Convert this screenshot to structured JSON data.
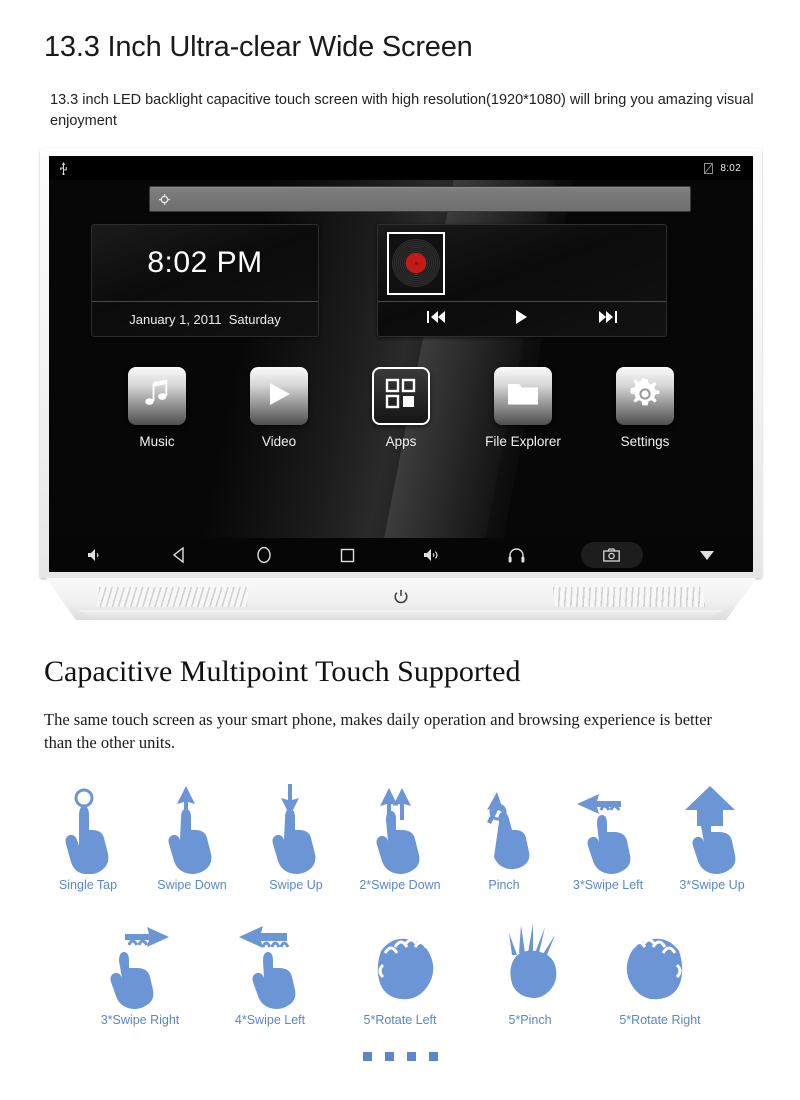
{
  "colors": {
    "accent_blue": "#5b87c9",
    "hand_blue": "#6c95d6",
    "screen_black": "#070707",
    "bezel_white": "#f4f4f4",
    "vinyl_red": "#c31a1a"
  },
  "section1": {
    "title": "13.3 Inch Ultra-clear Wide Screen",
    "description": "13.3 inch LED backlight capacitive touch screen with high resolution(1920*1080) will bring you amazing visual enjoyment"
  },
  "device": {
    "status_bar": {
      "left_icons": [
        "usb-icon"
      ],
      "right_icons": [
        "sd-card-icon"
      ],
      "time": "8:02"
    },
    "search_bar": {
      "icon": "google-search-icon",
      "value": "",
      "placeholder": ""
    },
    "clock_widget": {
      "time": "8:02 PM",
      "date": "January 1, 2011  Saturday"
    },
    "media_widget": {
      "album_art": "vinyl-record-icon",
      "controls": [
        {
          "name": "previous-track-button",
          "icon": "skip-previous-icon"
        },
        {
          "name": "play-button",
          "icon": "play-icon"
        },
        {
          "name": "next-track-button",
          "icon": "skip-next-icon"
        }
      ]
    },
    "apps": [
      {
        "label": "Music",
        "icon": "music-note-icon",
        "highlighted": false
      },
      {
        "label": "Video",
        "icon": "play-icon",
        "highlighted": false
      },
      {
        "label": "Apps",
        "icon": "app-grid-icon",
        "highlighted": true
      },
      {
        "label": "File Explorer",
        "icon": "folder-icon",
        "highlighted": false
      },
      {
        "label": "Settings",
        "icon": "gear-icon",
        "highlighted": false
      }
    ],
    "nav_buttons": [
      {
        "name": "volume-down-button",
        "icon": "volume-down-icon"
      },
      {
        "name": "back-button",
        "icon": "back-triangle-icon"
      },
      {
        "name": "home-button",
        "icon": "home-circle-icon"
      },
      {
        "name": "recents-button",
        "icon": "recents-square-icon"
      },
      {
        "name": "volume-up-button",
        "icon": "volume-up-icon"
      },
      {
        "name": "headphone-button",
        "icon": "headphone-icon"
      },
      {
        "name": "screenshot-button",
        "icon": "camera-icon"
      },
      {
        "name": "hide-navbar-button",
        "icon": "chevron-down-icon"
      }
    ],
    "base": {
      "power_icon": "power-icon"
    }
  },
  "section2": {
    "title": "Capacitive Multipoint Touch Supported",
    "description": "The same touch screen as your smart phone, makes daily operation and browsing experience is better than the other units.",
    "gestures_row1": [
      {
        "label": "Single Tap",
        "icon": "hand-single-tap-icon"
      },
      {
        "label": "Swipe Down",
        "icon": "hand-swipe-down-icon"
      },
      {
        "label": "Swipe Up",
        "icon": "hand-swipe-up-icon"
      },
      {
        "label": "2*Swipe Down",
        "icon": "hand-two-swipe-down-icon"
      },
      {
        "label": "Pinch",
        "icon": "hand-pinch-icon"
      },
      {
        "label": "3*Swipe Left",
        "icon": "hand-three-swipe-left-icon"
      },
      {
        "label": "3*Swipe Up",
        "icon": "hand-three-swipe-up-icon"
      }
    ],
    "gestures_row2": [
      {
        "label": "3*Swipe Right",
        "icon": "hand-three-swipe-right-icon"
      },
      {
        "label": "4*Swipe Left",
        "icon": "hand-four-swipe-left-icon"
      },
      {
        "label": "5*Rotate Left",
        "icon": "hand-five-rotate-left-icon"
      },
      {
        "label": "5*Pinch",
        "icon": "hand-five-pinch-icon"
      },
      {
        "label": "5*Rotate Right",
        "icon": "hand-five-rotate-right-icon"
      }
    ],
    "pagination_dots": 4
  }
}
